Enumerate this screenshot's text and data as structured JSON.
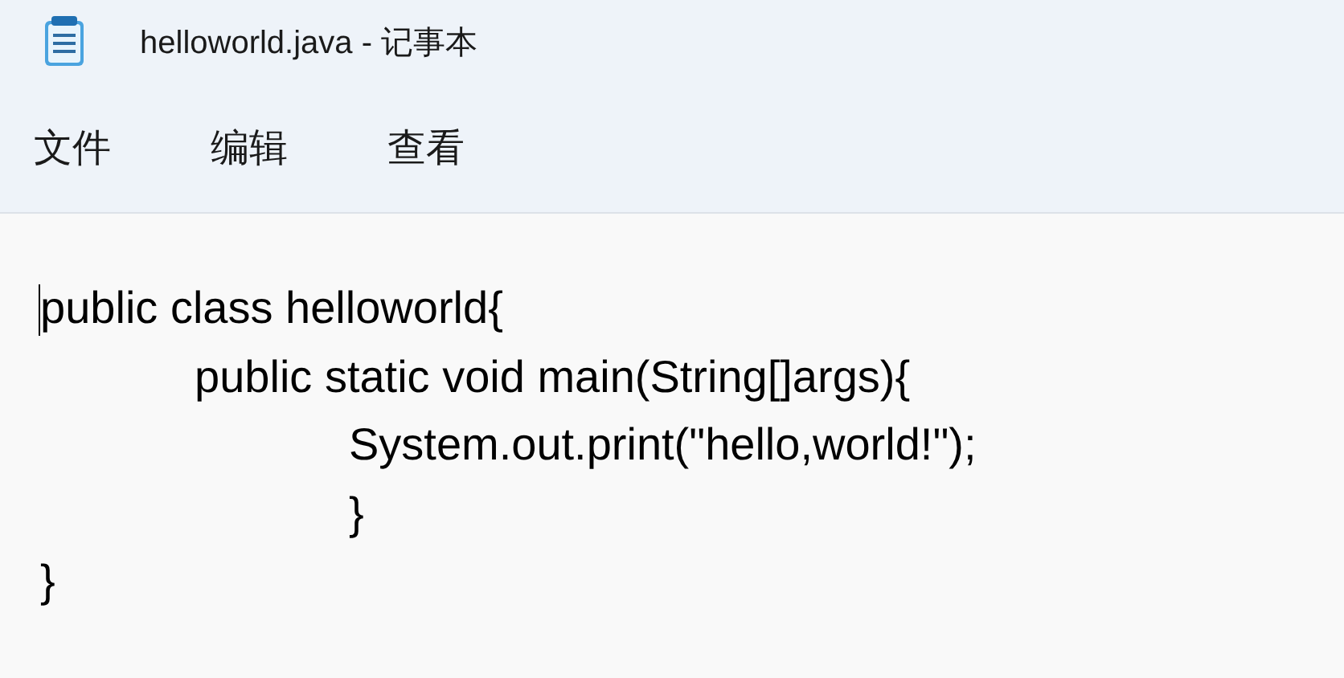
{
  "window": {
    "title": "helloworld.java - 记事本"
  },
  "menu": [
    "文件",
    "编辑",
    "查看"
  ],
  "editor": {
    "lines": [
      "public class helloworld{",
      "\tpublic static void main(String[]args){",
      "\t\tSystem.out.print(\"hello,world!\");",
      "\t\t}",
      "}"
    ]
  }
}
